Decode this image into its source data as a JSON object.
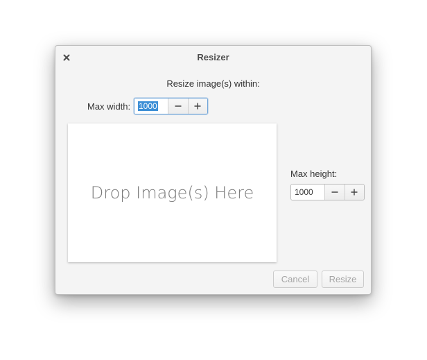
{
  "window": {
    "title": "Resizer",
    "close_icon": "close-icon"
  },
  "main": {
    "subtitle": "Resize image(s) within:",
    "max_width": {
      "label": "Max width:",
      "value": "1000",
      "decrement_icon": "minus-icon",
      "increment_icon": "plus-icon"
    },
    "max_height": {
      "label": "Max height:",
      "value": "1000",
      "decrement_icon": "minus-icon",
      "increment_icon": "plus-icon"
    },
    "drop_zone": {
      "text": "Drop Image(s) Here"
    }
  },
  "actions": {
    "cancel_label": "Cancel",
    "resize_label": "Resize"
  },
  "colors": {
    "window_bg": "#f4f4f4",
    "selection": "#3d8fd6",
    "focus_ring": "#6fa4d8",
    "disabled_text": "#a5a5a5"
  }
}
